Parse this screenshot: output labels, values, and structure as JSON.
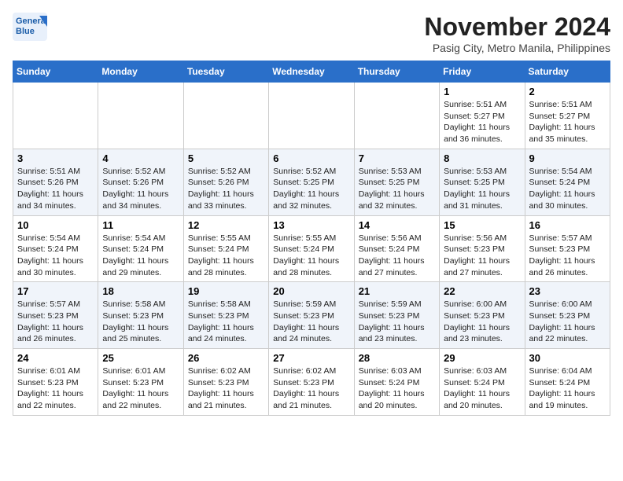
{
  "logo": {
    "line1": "General",
    "line2": "Blue"
  },
  "title": "November 2024",
  "location": "Pasig City, Metro Manila, Philippines",
  "weekdays": [
    "Sunday",
    "Monday",
    "Tuesday",
    "Wednesday",
    "Thursday",
    "Friday",
    "Saturday"
  ],
  "weeks": [
    [
      {
        "day": "",
        "info": ""
      },
      {
        "day": "",
        "info": ""
      },
      {
        "day": "",
        "info": ""
      },
      {
        "day": "",
        "info": ""
      },
      {
        "day": "",
        "info": ""
      },
      {
        "day": "1",
        "info": "Sunrise: 5:51 AM\nSunset: 5:27 PM\nDaylight: 11 hours\nand 36 minutes."
      },
      {
        "day": "2",
        "info": "Sunrise: 5:51 AM\nSunset: 5:27 PM\nDaylight: 11 hours\nand 35 minutes."
      }
    ],
    [
      {
        "day": "3",
        "info": "Sunrise: 5:51 AM\nSunset: 5:26 PM\nDaylight: 11 hours\nand 34 minutes."
      },
      {
        "day": "4",
        "info": "Sunrise: 5:52 AM\nSunset: 5:26 PM\nDaylight: 11 hours\nand 34 minutes."
      },
      {
        "day": "5",
        "info": "Sunrise: 5:52 AM\nSunset: 5:26 PM\nDaylight: 11 hours\nand 33 minutes."
      },
      {
        "day": "6",
        "info": "Sunrise: 5:52 AM\nSunset: 5:25 PM\nDaylight: 11 hours\nand 32 minutes."
      },
      {
        "day": "7",
        "info": "Sunrise: 5:53 AM\nSunset: 5:25 PM\nDaylight: 11 hours\nand 32 minutes."
      },
      {
        "day": "8",
        "info": "Sunrise: 5:53 AM\nSunset: 5:25 PM\nDaylight: 11 hours\nand 31 minutes."
      },
      {
        "day": "9",
        "info": "Sunrise: 5:54 AM\nSunset: 5:24 PM\nDaylight: 11 hours\nand 30 minutes."
      }
    ],
    [
      {
        "day": "10",
        "info": "Sunrise: 5:54 AM\nSunset: 5:24 PM\nDaylight: 11 hours\nand 30 minutes."
      },
      {
        "day": "11",
        "info": "Sunrise: 5:54 AM\nSunset: 5:24 PM\nDaylight: 11 hours\nand 29 minutes."
      },
      {
        "day": "12",
        "info": "Sunrise: 5:55 AM\nSunset: 5:24 PM\nDaylight: 11 hours\nand 28 minutes."
      },
      {
        "day": "13",
        "info": "Sunrise: 5:55 AM\nSunset: 5:24 PM\nDaylight: 11 hours\nand 28 minutes."
      },
      {
        "day": "14",
        "info": "Sunrise: 5:56 AM\nSunset: 5:24 PM\nDaylight: 11 hours\nand 27 minutes."
      },
      {
        "day": "15",
        "info": "Sunrise: 5:56 AM\nSunset: 5:23 PM\nDaylight: 11 hours\nand 27 minutes."
      },
      {
        "day": "16",
        "info": "Sunrise: 5:57 AM\nSunset: 5:23 PM\nDaylight: 11 hours\nand 26 minutes."
      }
    ],
    [
      {
        "day": "17",
        "info": "Sunrise: 5:57 AM\nSunset: 5:23 PM\nDaylight: 11 hours\nand 26 minutes."
      },
      {
        "day": "18",
        "info": "Sunrise: 5:58 AM\nSunset: 5:23 PM\nDaylight: 11 hours\nand 25 minutes."
      },
      {
        "day": "19",
        "info": "Sunrise: 5:58 AM\nSunset: 5:23 PM\nDaylight: 11 hours\nand 24 minutes."
      },
      {
        "day": "20",
        "info": "Sunrise: 5:59 AM\nSunset: 5:23 PM\nDaylight: 11 hours\nand 24 minutes."
      },
      {
        "day": "21",
        "info": "Sunrise: 5:59 AM\nSunset: 5:23 PM\nDaylight: 11 hours\nand 23 minutes."
      },
      {
        "day": "22",
        "info": "Sunrise: 6:00 AM\nSunset: 5:23 PM\nDaylight: 11 hours\nand 23 minutes."
      },
      {
        "day": "23",
        "info": "Sunrise: 6:00 AM\nSunset: 5:23 PM\nDaylight: 11 hours\nand 22 minutes."
      }
    ],
    [
      {
        "day": "24",
        "info": "Sunrise: 6:01 AM\nSunset: 5:23 PM\nDaylight: 11 hours\nand 22 minutes."
      },
      {
        "day": "25",
        "info": "Sunrise: 6:01 AM\nSunset: 5:23 PM\nDaylight: 11 hours\nand 22 minutes."
      },
      {
        "day": "26",
        "info": "Sunrise: 6:02 AM\nSunset: 5:23 PM\nDaylight: 11 hours\nand 21 minutes."
      },
      {
        "day": "27",
        "info": "Sunrise: 6:02 AM\nSunset: 5:23 PM\nDaylight: 11 hours\nand 21 minutes."
      },
      {
        "day": "28",
        "info": "Sunrise: 6:03 AM\nSunset: 5:24 PM\nDaylight: 11 hours\nand 20 minutes."
      },
      {
        "day": "29",
        "info": "Sunrise: 6:03 AM\nSunset: 5:24 PM\nDaylight: 11 hours\nand 20 minutes."
      },
      {
        "day": "30",
        "info": "Sunrise: 6:04 AM\nSunset: 5:24 PM\nDaylight: 11 hours\nand 19 minutes."
      }
    ]
  ]
}
